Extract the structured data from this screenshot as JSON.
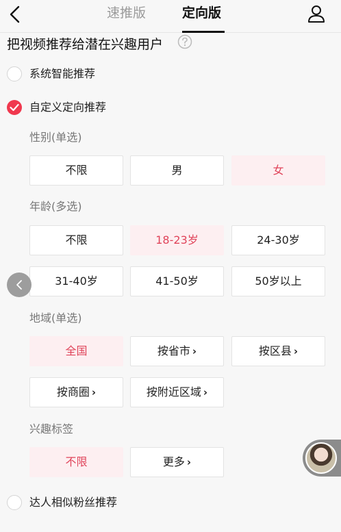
{
  "header": {
    "tab_quick": "速推版",
    "tab_targeted": "定向版",
    "icons": {
      "back": "chevron-left-icon",
      "user": "user-icon"
    }
  },
  "section": {
    "title": "把视频推荐给潜在兴趣用户",
    "help_icon": "question-circle-icon"
  },
  "modes": {
    "system": {
      "label": "系统智能推荐",
      "checked": false
    },
    "custom": {
      "label": "自定义定向推荐",
      "checked": true
    },
    "lookalike": {
      "label": "达人相似粉丝推荐",
      "checked": false
    }
  },
  "gender": {
    "label": "性别(单选)",
    "options": [
      "不限",
      "男",
      "女"
    ],
    "selected": "女"
  },
  "age": {
    "label": "年龄(多选)",
    "options": [
      "不限",
      "18-23岁",
      "24-30岁",
      "31-40岁",
      "41-50岁",
      "50岁以上"
    ],
    "selected": [
      "18-23岁"
    ]
  },
  "region": {
    "label": "地域(单选)",
    "options": [
      "全国",
      "按省市",
      "按区县",
      "按商圈",
      "按附近区域"
    ],
    "selected": "全国",
    "chevron": "›"
  },
  "interest": {
    "label": "兴趣标签",
    "options": [
      "不限",
      "更多"
    ],
    "selected": "不限"
  },
  "colors": {
    "accent": "#f0384e",
    "selected_bg": "#fdeff1",
    "selected_text": "#e0445a"
  },
  "floating": {
    "side_arrow_icon": "chevron-left-icon",
    "avatar": "avatar"
  }
}
